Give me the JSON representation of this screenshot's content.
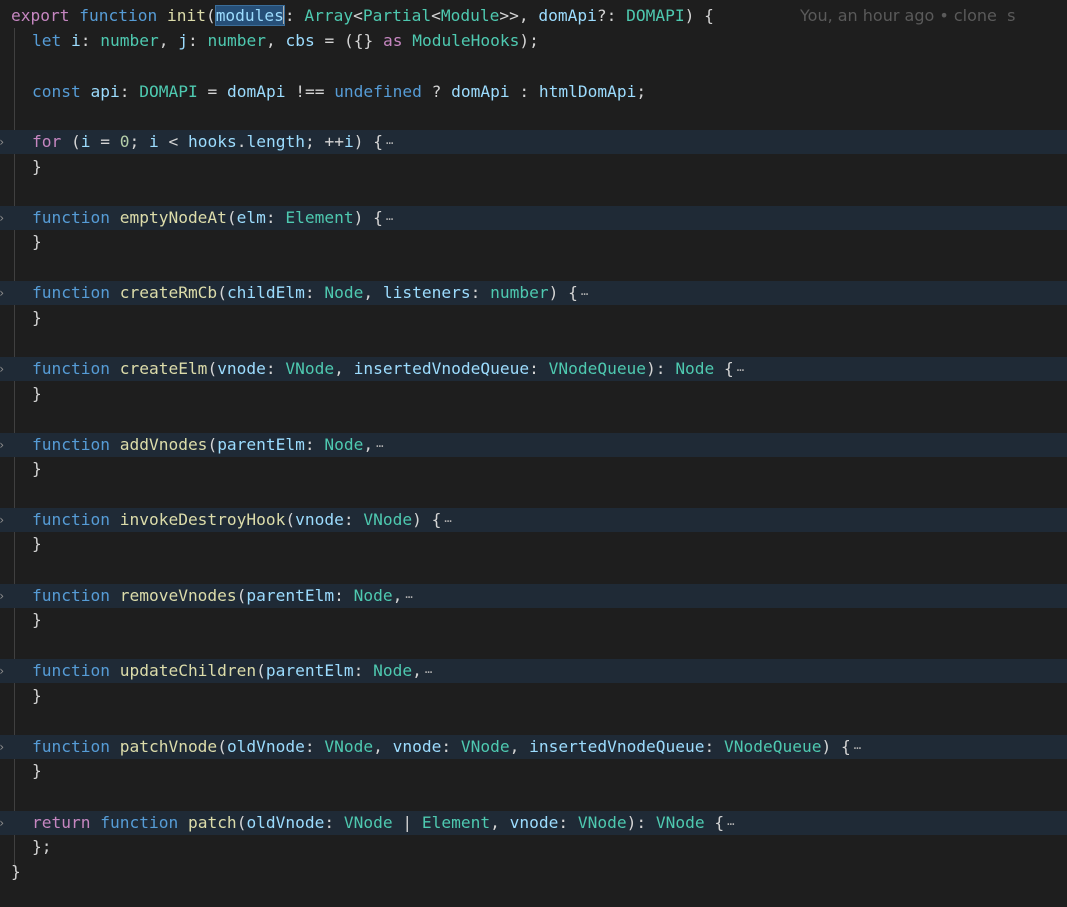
{
  "blame": "You, an hour ago • clone  s",
  "ellipsis": "⋯",
  "line1": {
    "t1": "export",
    "t2": " ",
    "t3": "function",
    "t4": " ",
    "t5": "init",
    "t6": "(",
    "t7": "modules",
    "t8": ": ",
    "t9": "Array",
    "t10": "<",
    "t11": "Partial",
    "t12": "<",
    "t13": "Module",
    "t14": ">>, ",
    "t15": "domApi",
    "t16": "?: ",
    "t17": "DOMAPI",
    "t18": ") {"
  },
  "line2": {
    "t1": "let",
    "t2": " ",
    "t3": "i",
    "t4": ": ",
    "t5": "number",
    "t6": ", ",
    "t7": "j",
    "t8": ": ",
    "t9": "number",
    "t10": ", ",
    "t11": "cbs",
    "t12": " = ({} ",
    "t13": "as",
    "t14": " ",
    "t15": "ModuleHooks",
    "t16": ");"
  },
  "line3": {
    "t1": "const",
    "t2": " ",
    "t3": "api",
    "t4": ": ",
    "t5": "DOMAPI",
    "t6": " = ",
    "t7": "domApi",
    "t8": " !== ",
    "t9": "undefined",
    "t10": " ? ",
    "t11": "domApi",
    "t12": " : ",
    "t13": "htmlDomApi",
    "t14": ";"
  },
  "fold1": {
    "t1": "for",
    "t2": " (",
    "t3": "i",
    "t4": " = ",
    "t5": "0",
    "t6": "; ",
    "t7": "i",
    "t8": " < ",
    "t9": "hooks",
    "t10": ".",
    "t11": "length",
    "t12": "; ++",
    "t13": "i",
    "t14": ") {"
  },
  "fold2": {
    "t1": "function",
    "t2": " ",
    "t3": "emptyNodeAt",
    "t4": "(",
    "t5": "elm",
    "t6": ": ",
    "t7": "Element",
    "t8": ") {"
  },
  "fold3": {
    "t1": "function",
    "t2": " ",
    "t3": "createRmCb",
    "t4": "(",
    "t5": "childElm",
    "t6": ": ",
    "t7": "Node",
    "t8": ", ",
    "t9": "listeners",
    "t10": ": ",
    "t11": "number",
    "t12": ") {"
  },
  "fold4": {
    "t1": "function",
    "t2": " ",
    "t3": "createElm",
    "t4": "(",
    "t5": "vnode",
    "t6": ": ",
    "t7": "VNode",
    "t8": ", ",
    "t9": "insertedVnodeQueue",
    "t10": ": ",
    "t11": "VNodeQueue",
    "t12": "): ",
    "t13": "Node",
    "t14": " {"
  },
  "fold5": {
    "t1": "function",
    "t2": " ",
    "t3": "addVnodes",
    "t4": "(",
    "t5": "parentElm",
    "t6": ": ",
    "t7": "Node",
    "t8": ","
  },
  "fold6": {
    "t1": "function",
    "t2": " ",
    "t3": "invokeDestroyHook",
    "t4": "(",
    "t5": "vnode",
    "t6": ": ",
    "t7": "VNode",
    "t8": ") {"
  },
  "fold7": {
    "t1": "function",
    "t2": " ",
    "t3": "removeVnodes",
    "t4": "(",
    "t5": "parentElm",
    "t6": ": ",
    "t7": "Node",
    "t8": ","
  },
  "fold8": {
    "t1": "function",
    "t2": " ",
    "t3": "updateChildren",
    "t4": "(",
    "t5": "parentElm",
    "t6": ": ",
    "t7": "Node",
    "t8": ","
  },
  "fold9": {
    "t1": "function",
    "t2": " ",
    "t3": "patchVnode",
    "t4": "(",
    "t5": "oldVnode",
    "t6": ": ",
    "t7": "VNode",
    "t8": ", ",
    "t9": "vnode",
    "t10": ": ",
    "t11": "VNode",
    "t12": ", ",
    "t13": "insertedVnodeQueue",
    "t14": ": ",
    "t15": "VNodeQueue",
    "t16": ") {"
  },
  "fold10": {
    "t1": "return",
    "t2": " ",
    "t3": "function",
    "t4": " ",
    "t5": "patch",
    "t6": "(",
    "t7": "oldVnode",
    "t8": ": ",
    "t9": "VNode",
    "t10": " | ",
    "t11": "Element",
    "t12": ", ",
    "t13": "vnode",
    "t14": ": ",
    "t15": "VNode",
    "t16": "): ",
    "t17": "VNode",
    "t18": " {"
  },
  "closings": {
    "brace": "}",
    "brace_semi": "};"
  }
}
